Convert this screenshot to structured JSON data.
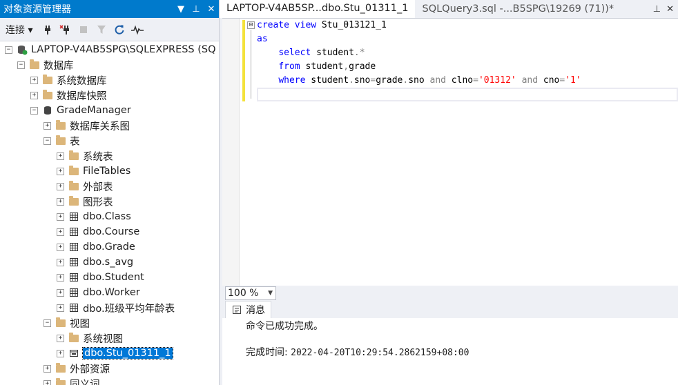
{
  "object_explorer": {
    "title": "对象资源管理器",
    "title_controls": [
      "▼",
      "⊥",
      "✕"
    ],
    "toolbar": {
      "connect_label": "连接",
      "connect_dropdown": "▾",
      "icons": [
        "connect-icon",
        "disconnect-icon",
        "stop-icon",
        "filter-icon",
        "refresh-icon",
        "activity-monitor-icon"
      ]
    },
    "tree": {
      "server": "LAPTOP-V4AB5SPG\\SQLEXPRESS (SQ",
      "databases": "数据库",
      "system_databases": "系统数据库",
      "db_snapshots": "数据库快照",
      "grade_manager": "GradeManager",
      "db_diagrams": "数据库关系图",
      "tables": "表",
      "system_tables": "系统表",
      "file_tables": "FileTables",
      "external_tables": "外部表",
      "graph_tables": "图形表",
      "table_items": [
        "dbo.Class",
        "dbo.Course",
        "dbo.Grade",
        "dbo.s_avg",
        "dbo.Student",
        "dbo.Worker",
        "dbo.班级平均年龄表"
      ],
      "views": "视图",
      "system_views": "系统视图",
      "selected_view": "dbo.Stu_01311_1",
      "external_resources": "外部资源",
      "synonyms": "同义词"
    }
  },
  "document_tabs": {
    "active": "LAPTOP-V4AB5SP...dbo.Stu_01311_1",
    "inactive": "SQLQuery3.sql -...B5SPG\\19269 (71))*",
    "controls": [
      "⊥",
      "✕"
    ]
  },
  "editor": {
    "outline_toggle": "⊟",
    "lines": [
      [
        {
          "t": "kw",
          "v": "create"
        },
        {
          "t": "plain",
          "v": " "
        },
        {
          "t": "kw",
          "v": "view"
        },
        {
          "t": "plain",
          "v": " Stu_013121_1"
        }
      ],
      [
        {
          "t": "kw",
          "v": "as"
        }
      ],
      [
        {
          "t": "plain",
          "v": "    "
        },
        {
          "t": "kw",
          "v": "select"
        },
        {
          "t": "plain",
          "v": " student"
        },
        {
          "t": "op",
          "v": "."
        },
        {
          "t": "op",
          "v": "*"
        }
      ],
      [
        {
          "t": "plain",
          "v": "    "
        },
        {
          "t": "kw",
          "v": "from"
        },
        {
          "t": "plain",
          "v": " student"
        },
        {
          "t": "op",
          "v": ","
        },
        {
          "t": "plain",
          "v": "grade"
        }
      ],
      [
        {
          "t": "plain",
          "v": "    "
        },
        {
          "t": "kw",
          "v": "where"
        },
        {
          "t": "plain",
          "v": " student"
        },
        {
          "t": "op",
          "v": "."
        },
        {
          "t": "plain",
          "v": "sno"
        },
        {
          "t": "op",
          "v": "="
        },
        {
          "t": "plain",
          "v": "grade"
        },
        {
          "t": "op",
          "v": "."
        },
        {
          "t": "plain",
          "v": "sno "
        },
        {
          "t": "op",
          "v": "and"
        },
        {
          "t": "plain",
          "v": " clno"
        },
        {
          "t": "op",
          "v": "="
        },
        {
          "t": "str",
          "v": "'01312'"
        },
        {
          "t": "plain",
          "v": " "
        },
        {
          "t": "op",
          "v": "and"
        },
        {
          "t": "plain",
          "v": " cno"
        },
        {
          "t": "op",
          "v": "="
        },
        {
          "t": "str",
          "v": "'1'"
        }
      ]
    ]
  },
  "zoom": {
    "value": "100 %",
    "dropdown": "▼"
  },
  "results": {
    "tab_label": "消息",
    "message": "命令已成功完成。",
    "completion_label": "完成时间: ",
    "completion_time": "2022-04-20T10:29:54.2862159+08:00"
  },
  "colors": {
    "title_bar": "#007acc",
    "keyword": "#0000ff",
    "operator": "#808080",
    "string": "#ff0000",
    "selection": "#0078d7",
    "change_margin": "#f4e23a"
  }
}
